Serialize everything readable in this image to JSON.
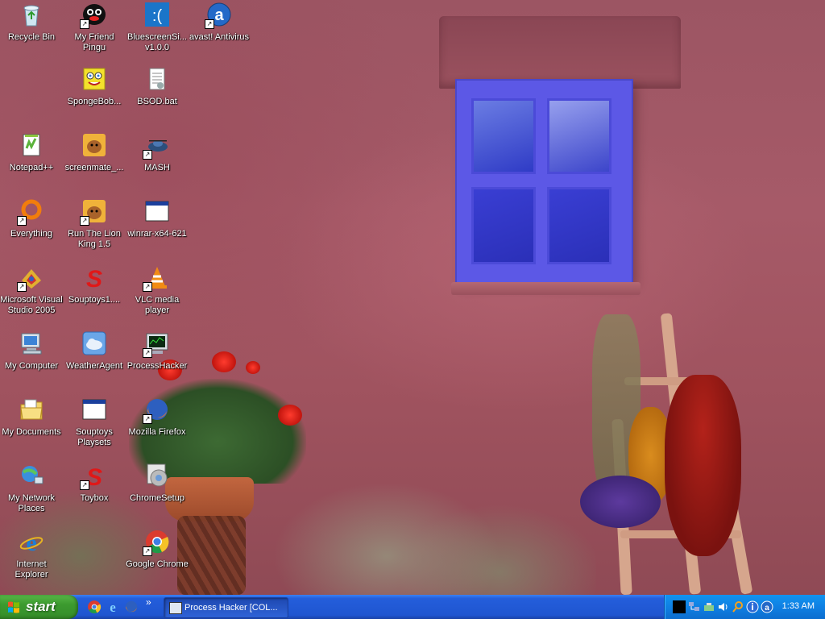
{
  "desktop": {
    "icons": [
      {
        "label": "Recycle Bin",
        "icon": "recycle-bin-icon"
      },
      {
        "label": "My Friend Pingu",
        "icon": "pingu-icon"
      },
      {
        "label": "BluescreenSi... v1.0.0",
        "icon": "bluescreen-icon"
      },
      {
        "label": "avast! Antivirus",
        "icon": "avast-icon"
      },
      {
        "label": "SpongeBob...",
        "icon": "spongebob-icon"
      },
      {
        "label": "BSOD.bat",
        "icon": "batch-file-icon"
      },
      {
        "label": "Notepad++",
        "icon": "notepadpp-icon"
      },
      {
        "label": "screenmate_...",
        "icon": "screenmate-icon"
      },
      {
        "label": "MASH",
        "icon": "mash-icon"
      },
      {
        "label": "Everything",
        "icon": "everything-icon"
      },
      {
        "label": "Run The Lion King 1.5",
        "icon": "lion-king-icon"
      },
      {
        "label": "winrar-x64-621",
        "icon": "installer-window-icon"
      },
      {
        "label": "Microsoft Visual Studio 2005",
        "icon": "visual-studio-icon"
      },
      {
        "label": "Souptoys1....",
        "icon": "souptoys-icon"
      },
      {
        "label": "VLC media player",
        "icon": "vlc-icon"
      },
      {
        "label": "My Computer",
        "icon": "my-computer-icon"
      },
      {
        "label": "WeatherAgent",
        "icon": "weather-agent-icon"
      },
      {
        "label": "ProcessHacker",
        "icon": "process-hacker-icon"
      },
      {
        "label": "My Documents",
        "icon": "my-documents-icon"
      },
      {
        "label": "Souptoys Playsets",
        "icon": "window-app-icon"
      },
      {
        "label": "Mozilla Firefox",
        "icon": "firefox-icon"
      },
      {
        "label": "My Network Places",
        "icon": "network-places-icon"
      },
      {
        "label": "Toybox",
        "icon": "toybox-icon"
      },
      {
        "label": "ChromeSetup",
        "icon": "chrome-setup-icon"
      },
      {
        "label": "Internet Explorer",
        "icon": "internet-explorer-icon"
      },
      {
        "label": "Google Chrome",
        "icon": "chrome-icon"
      }
    ]
  },
  "taskbar": {
    "start_label": "start",
    "quick_launch": [
      "chrome-icon",
      "internet-explorer-icon",
      "firefox-icon"
    ],
    "overflow_chevron": "»",
    "task_item": "Process Hacker [COL...",
    "tray_icons": [
      "black-square-icon",
      "network-icon",
      "safely-remove-hardware-icon",
      "volume-icon",
      "search-icon",
      "info-icon",
      "avast-icon"
    ],
    "clock": "1:33 AM"
  },
  "colors": {
    "taskbar_blue": "#245edb",
    "start_green": "#3c9a2f",
    "tray_blue": "#0f80e3"
  }
}
